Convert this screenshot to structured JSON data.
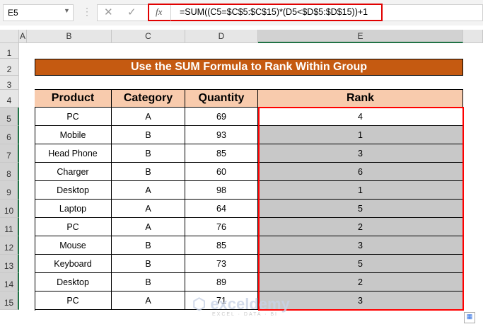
{
  "name_box": "E5",
  "formula": "=SUM((C5=$C$5:$C$15)*(D5<$D$5:$D$15))+1",
  "columns": [
    "A",
    "B",
    "C",
    "D",
    "E"
  ],
  "rows": [
    "1",
    "2",
    "3",
    "4",
    "5",
    "6",
    "7",
    "8",
    "9",
    "10",
    "11",
    "12",
    "13",
    "14",
    "15"
  ],
  "title": "Use the SUM Formula to Rank Within Group",
  "headers": [
    "Product",
    "Category",
    "Quantity",
    "Rank"
  ],
  "data": [
    [
      "PC",
      "A",
      "69",
      "4"
    ],
    [
      "Mobile",
      "B",
      "93",
      "1"
    ],
    [
      "Head Phone",
      "B",
      "85",
      "3"
    ],
    [
      "Charger",
      "B",
      "60",
      "6"
    ],
    [
      "Desktop",
      "A",
      "98",
      "1"
    ],
    [
      "Laptop",
      "A",
      "64",
      "5"
    ],
    [
      "PC",
      "A",
      "76",
      "2"
    ],
    [
      "Mouse",
      "B",
      "85",
      "3"
    ],
    [
      "Keyboard",
      "B",
      "73",
      "5"
    ],
    [
      "Desktop",
      "B",
      "89",
      "2"
    ],
    [
      "PC",
      "A",
      "71",
      "3"
    ]
  ],
  "watermark": {
    "name": "exceldemy",
    "tagline": "EXCEL · DATA · BI"
  },
  "colors": {
    "title_bg": "#c55a11",
    "header_bg": "#f8cbad",
    "selection_border": "#ff0000",
    "selected_fill": "#c8c8c8"
  }
}
